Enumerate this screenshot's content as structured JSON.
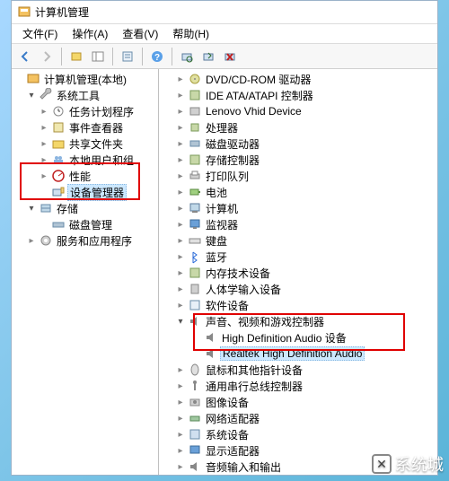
{
  "window": {
    "title": "计算机管理"
  },
  "menu": {
    "file": "文件(F)",
    "action": "操作(A)",
    "view": "查看(V)",
    "help": "帮助(H)"
  },
  "left_tree": {
    "root": "计算机管理(本地)",
    "system_tools": "系统工具",
    "task_scheduler": "任务计划程序",
    "event_viewer": "事件查看器",
    "shared_folders": "共享文件夹",
    "local_users": "本地用户和组",
    "performance": "性能",
    "device_manager": "设备管理器",
    "storage": "存储",
    "disk_mgmt": "磁盘管理",
    "services_apps": "服务和应用程序"
  },
  "right_tree": [
    {
      "label": "DVD/CD-ROM 驱动器",
      "icon": "disc"
    },
    {
      "label": "IDE ATA/ATAPI 控制器",
      "icon": "chip"
    },
    {
      "label": "Lenovo Vhid Device",
      "icon": "device"
    },
    {
      "label": "处理器",
      "icon": "cpu"
    },
    {
      "label": "磁盘驱动器",
      "icon": "disk"
    },
    {
      "label": "存储控制器",
      "icon": "chip"
    },
    {
      "label": "打印队列",
      "icon": "printer"
    },
    {
      "label": "电池",
      "icon": "battery"
    },
    {
      "label": "计算机",
      "icon": "computer"
    },
    {
      "label": "监视器",
      "icon": "monitor"
    },
    {
      "label": "键盘",
      "icon": "keyboard"
    },
    {
      "label": "蓝牙",
      "icon": "bt"
    },
    {
      "label": "内存技术设备",
      "icon": "chip"
    },
    {
      "label": "人体学输入设备",
      "icon": "hid"
    },
    {
      "label": "软件设备",
      "icon": "soft"
    }
  ],
  "sound_category": "声音、视频和游戏控制器",
  "sound_items": [
    "High Definition Audio 设备",
    "Realtek High Definition Audio"
  ],
  "right_tree_after": [
    {
      "label": "鼠标和其他指针设备",
      "icon": "mouse"
    },
    {
      "label": "通用串行总线控制器",
      "icon": "usb"
    },
    {
      "label": "图像设备",
      "icon": "camera"
    },
    {
      "label": "网络适配器",
      "icon": "net"
    },
    {
      "label": "系统设备",
      "icon": "sys"
    },
    {
      "label": "显示适配器",
      "icon": "display"
    },
    {
      "label": "音频输入和输出",
      "icon": "speaker"
    }
  ],
  "watermark": "系统城"
}
